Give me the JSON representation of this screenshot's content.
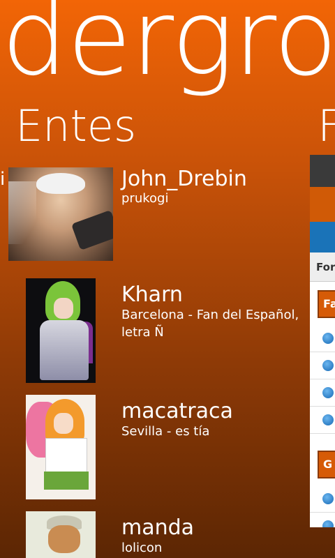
{
  "app_title": "dergro",
  "section_title": "Entes",
  "next_section_peek": "F",
  "prev_section_peek": "i",
  "users": [
    {
      "name": "John_Drebin",
      "subtitle": "prukogi",
      "avatar": "avatar-john-drebin"
    },
    {
      "name": "Kharn",
      "subtitle": "Barcelona - Fan del Español, letra Ñ",
      "avatar": "avatar-kharn"
    },
    {
      "name": "macatraca",
      "subtitle": "Sevilla - es tía",
      "avatar": "avatar-macatraca"
    },
    {
      "name": "manda",
      "subtitle": "lolicon",
      "avatar": "avatar-manda"
    }
  ],
  "peek_panel": {
    "forum_label": "For",
    "category_1": "Fa",
    "category_2": "G"
  },
  "colors": {
    "accent": "#f26506",
    "background_bottom": "#5c2604",
    "link_blue": "#1a73b8"
  }
}
